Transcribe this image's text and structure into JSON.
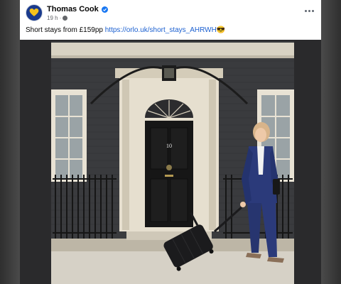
{
  "post": {
    "author": "Thomas Cook",
    "time": "19 h",
    "separator": "·",
    "caption_text": "Short stays from £159pp ",
    "caption_link": "https://orlo.uk/short_stays_AHRWH",
    "caption_emoji": "😎",
    "door_number": "10"
  },
  "colors": {
    "verified": "#1877f2",
    "link": "#1a5fd0",
    "brand_avatar": "#1a3a8c",
    "suit": "#2b3a7a"
  },
  "icons": {
    "avatar": "heart-logo-icon",
    "verified": "verified-badge-icon",
    "audience": "globe-icon",
    "more": "more-options-icon"
  }
}
